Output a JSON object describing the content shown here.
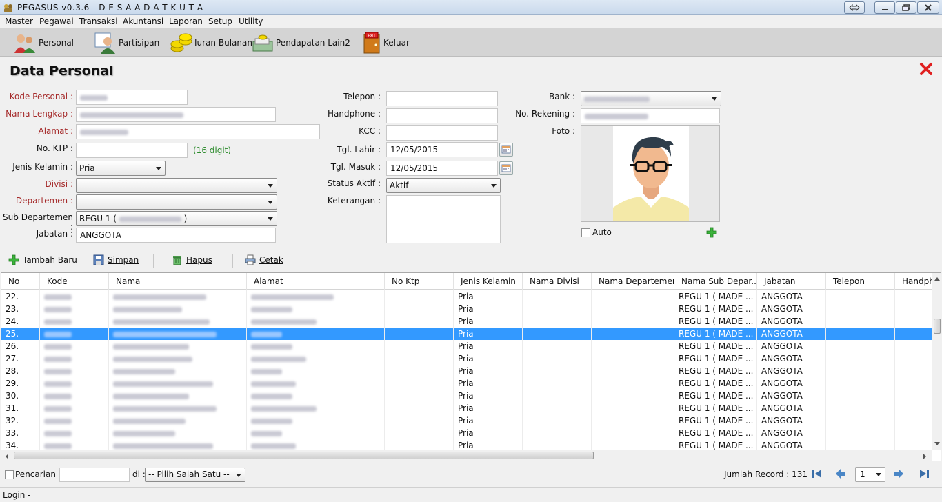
{
  "window": {
    "title": "PEGASUS v0.3.6 - D E S A  A D A T  K U T A"
  },
  "menu": [
    "Master",
    "Pegawai",
    "Transaksi",
    "Akuntansi",
    "Laporan",
    "Setup",
    "Utility"
  ],
  "toolbar": {
    "personal": "Personal",
    "partisipan": "Partisipan",
    "iuran": "Iuran Bulanan",
    "pendapatan": "Pendapatan Lain2",
    "keluar": "Keluar"
  },
  "page_title": "Data Personal",
  "form": {
    "kode_label": "Kode Personal :",
    "nama_label": "Nama Lengkap :",
    "alamat_label": "Alamat :",
    "ktp_label": "No. KTP :",
    "ktp_hint": "(16 digit)",
    "jk_label": "Jenis Kelamin :",
    "jk_value": "Pria",
    "divisi_label": "Divisi :",
    "departemen_label": "Departemen :",
    "subdep_label": "Sub Departemen :",
    "subdep_prefix": "REGU 1 (",
    "subdep_suffix": ")",
    "jabatan_label": "Jabatan :",
    "jabatan_value": "ANGGOTA",
    "telepon_label": "Telepon :",
    "handphone_label": "Handphone :",
    "kcc_label": "KCC :",
    "tgl_lahir_label": "Tgl. Lahir :",
    "tgl_lahir_value": "12/05/2015",
    "tgl_masuk_label": "Tgl. Masuk :",
    "tgl_masuk_value": "12/05/2015",
    "status_label": "Status Aktif :",
    "status_value": "Aktif",
    "keterangan_label": "Keterangan :",
    "bank_label": "Bank :",
    "rekening_label": "No. Rekening :",
    "foto_label": "Foto :",
    "auto_label": "Auto"
  },
  "actions": {
    "tambah": "Tambah Baru",
    "simpan": "Simpan",
    "hapus": "Hapus",
    "cetak": "Cetak"
  },
  "grid": {
    "columns": [
      "No",
      "Kode",
      "Nama",
      "Alamat",
      "No Ktp",
      "Jenis Kelamin",
      "Nama Divisi",
      "Nama Departemen",
      "Nama Sub Depar...",
      "Jabatan",
      "Telepon",
      "Handph"
    ],
    "rows": [
      {
        "no": "22.",
        "jk": "Pria",
        "sub": "REGU 1 ( MADE ...",
        "jab": "ANGGOTA"
      },
      {
        "no": "23.",
        "jk": "Pria",
        "sub": "REGU 1 ( MADE ...",
        "jab": "ANGGOTA"
      },
      {
        "no": "24.",
        "jk": "Pria",
        "sub": "REGU 1 ( MADE ...",
        "jab": "ANGGOTA"
      },
      {
        "no": "25.",
        "jk": "Pria",
        "sub": "REGU 1 ( MADE ...",
        "jab": "ANGGOTA"
      },
      {
        "no": "26.",
        "jk": "Pria",
        "sub": "REGU 1 ( MADE ...",
        "jab": "ANGGOTA"
      },
      {
        "no": "27.",
        "jk": "Pria",
        "sub": "REGU 1 ( MADE ...",
        "jab": "ANGGOTA"
      },
      {
        "no": "28.",
        "jk": "Pria",
        "sub": "REGU 1 ( MADE ...",
        "jab": "ANGGOTA"
      },
      {
        "no": "29.",
        "jk": "Pria",
        "sub": "REGU 1 ( MADE ...",
        "jab": "ANGGOTA"
      },
      {
        "no": "30.",
        "jk": "Pria",
        "sub": "REGU 1 ( MADE ...",
        "jab": "ANGGOTA"
      },
      {
        "no": "31.",
        "jk": "Pria",
        "sub": "REGU 1 ( MADE ...",
        "jab": "ANGGOTA"
      },
      {
        "no": "32.",
        "jk": "Pria",
        "sub": "REGU 1 ( MADE ...",
        "jab": "ANGGOTA"
      },
      {
        "no": "33.",
        "jk": "Pria",
        "sub": "REGU 1 ( MADE ...",
        "jab": "ANGGOTA"
      },
      {
        "no": "34.",
        "jk": "Pria",
        "sub": "REGU 1 ( MADE ...",
        "jab": "ANGGOTA"
      }
    ]
  },
  "footer": {
    "pencarian_label": "Pencarian :",
    "di_label": "di :",
    "pilih": "-- Pilih Salah Satu --",
    "jumlah_label": "Jumlah Record : 131",
    "page_value": "1"
  },
  "status": "Login -",
  "colors": {
    "selected_row": "#3399ff",
    "required_label": "#a52a2a",
    "hint": "#2a8a2a",
    "close": "#e02020"
  }
}
